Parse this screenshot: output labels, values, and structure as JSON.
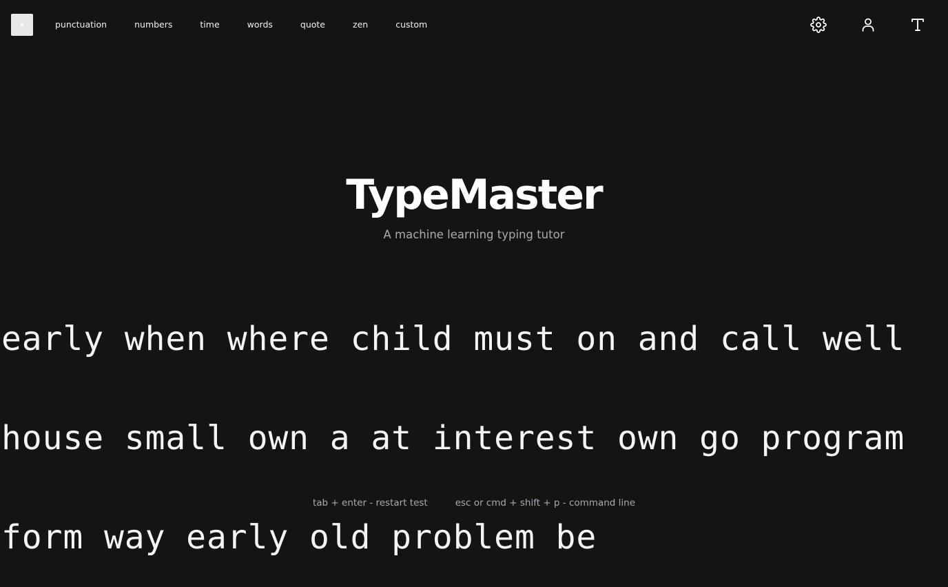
{
  "nav": {
    "modes": [
      "punctuation",
      "numbers",
      "time",
      "words",
      "quote",
      "zen",
      "custom"
    ]
  },
  "icons": {
    "logo": "app-logo-icon",
    "settings": "gear-icon",
    "account": "user-icon",
    "font": "text-t-icon"
  },
  "hero": {
    "title": "TypeMaster",
    "subtitle": "A machine learning typing tutor"
  },
  "words": {
    "lines": [
      "early when where child must on and call well",
      "house small own a at interest own go program",
      "form way early old problem be"
    ]
  },
  "footer": {
    "restart_hint": "tab + enter - restart test",
    "command_hint": "esc or cmd + shift + p - command line"
  },
  "colors": {
    "background": "#141414",
    "text": "#f5f5f5",
    "muted": "#a7abb2"
  }
}
